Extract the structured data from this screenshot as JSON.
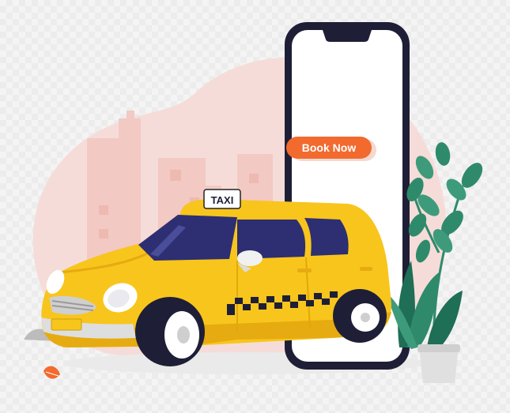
{
  "taxi_sign": {
    "label": "TAXI"
  },
  "cta": {
    "label": "Book Now"
  },
  "colors": {
    "blob": "#f6dcd8",
    "buildings": "#f2c9c3",
    "taxi_yellow": "#f8c51c",
    "taxi_shade": "#e6ab10",
    "phone_frame": "#1e1f36",
    "button": "#f26a2e",
    "leaf_green": "#2f8a6c",
    "pot": "#e0e0e0"
  },
  "icons": [
    "taxi-car-illustration",
    "smartphone-illustration",
    "potted-plant-icon",
    "leaf-icon",
    "checker-stripe"
  ]
}
